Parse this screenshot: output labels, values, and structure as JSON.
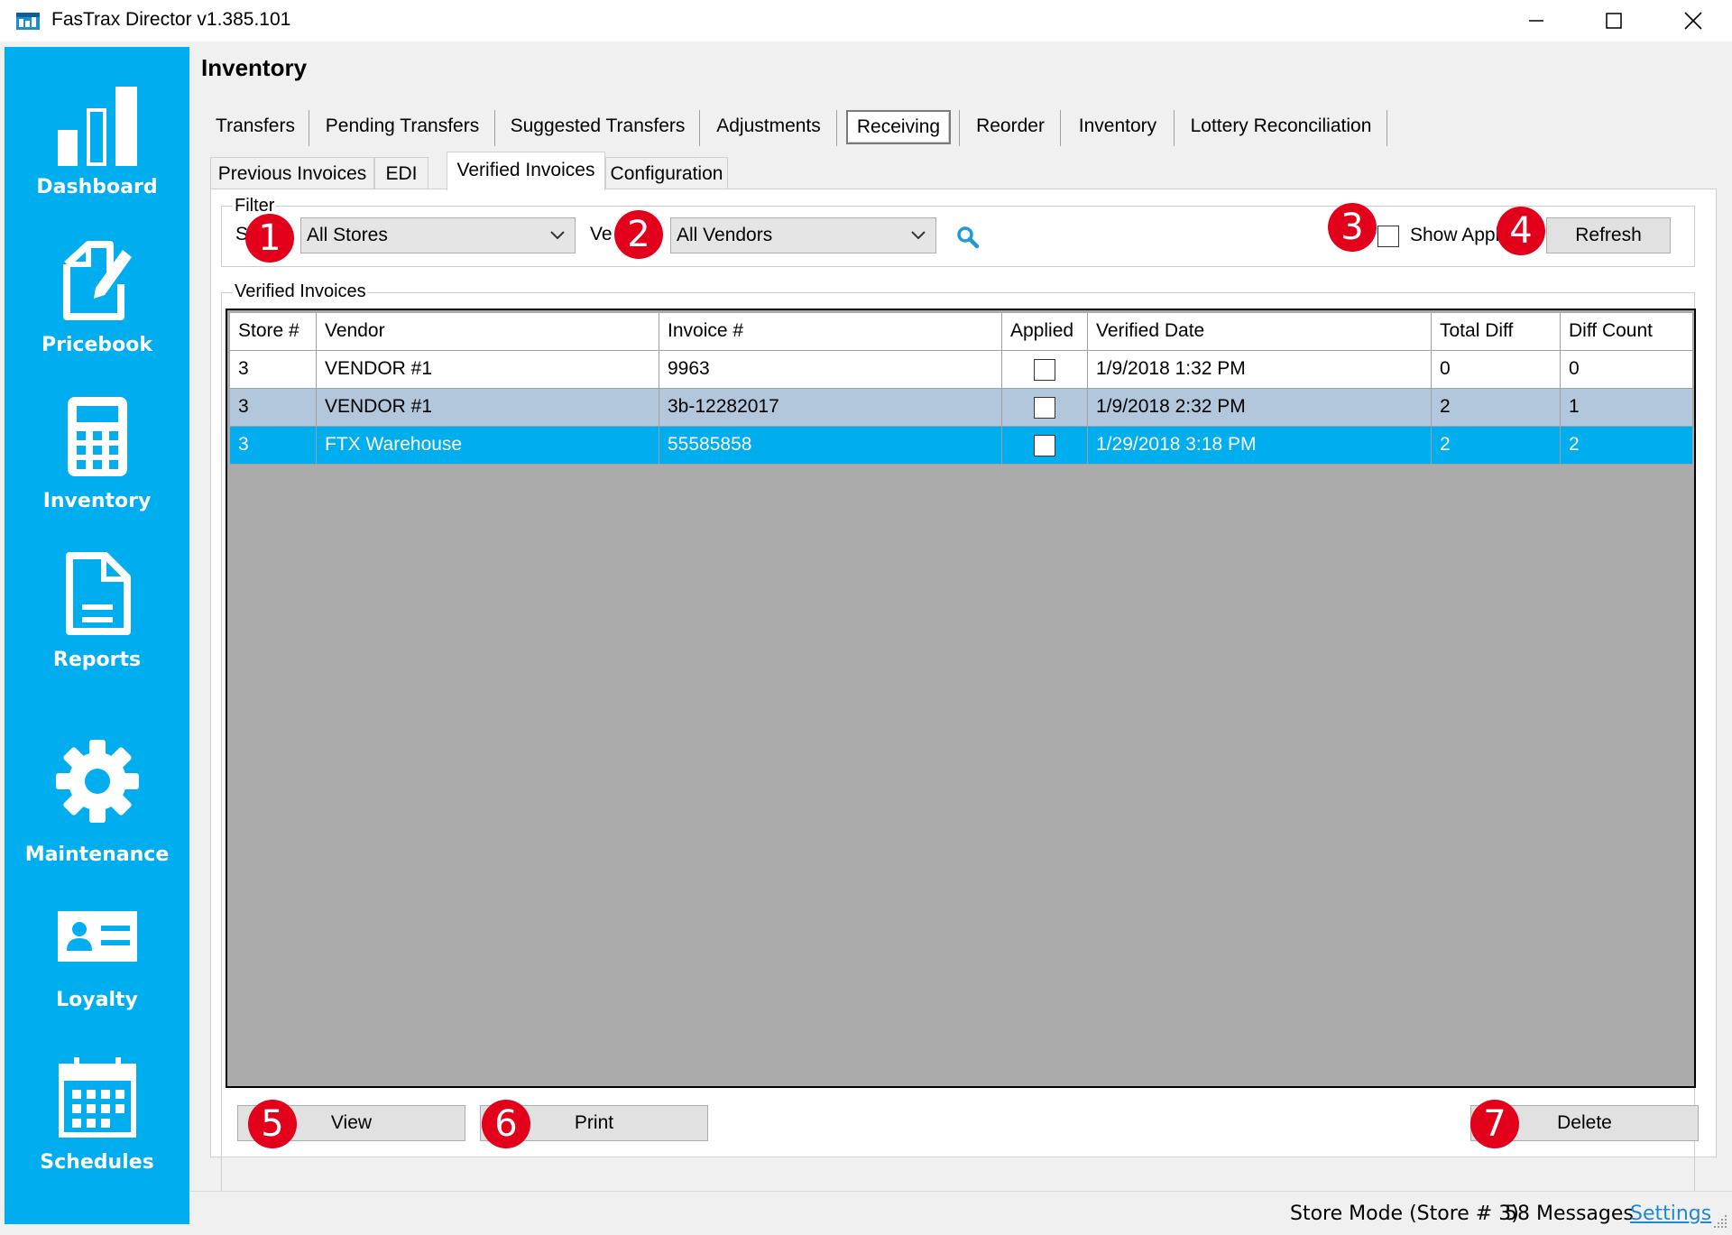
{
  "window": {
    "title": "FasTrax Director v1.385.101",
    "minimize_label": "—",
    "maximize_label": "☐",
    "close_label": "✕"
  },
  "sidebar": {
    "items": [
      {
        "label": "Dashboard",
        "icon": "bar-chart-icon"
      },
      {
        "label": "Pricebook",
        "icon": "edit-document-icon"
      },
      {
        "label": "Inventory",
        "icon": "calculator-icon"
      },
      {
        "label": "Reports",
        "icon": "document-icon"
      },
      {
        "label": "Maintenance",
        "icon": "gear-icon"
      },
      {
        "label": "Loyalty",
        "icon": "id-card-icon"
      },
      {
        "label": "Schedules",
        "icon": "calendar-icon"
      }
    ]
  },
  "page": {
    "title": "Inventory"
  },
  "main_tabs": [
    {
      "label": "Transfers"
    },
    {
      "label": "Pending Transfers"
    },
    {
      "label": "Suggested Transfers"
    },
    {
      "label": "Adjustments"
    },
    {
      "label": "Receiving",
      "active": true
    },
    {
      "label": "Reorder"
    },
    {
      "label": "Inventory"
    },
    {
      "label": "Lottery Reconciliation"
    }
  ],
  "sub_tabs": [
    {
      "label": "Previous Invoices"
    },
    {
      "label": "EDI"
    },
    {
      "label": "Verified Invoices",
      "active": true
    },
    {
      "label": "Configuration"
    }
  ],
  "filter": {
    "group_label": "Filter",
    "store_label_partial": "S",
    "store_value": "All Stores",
    "vendor_label_partial": "Ve",
    "vendor_value": "All Vendors",
    "show_applied_label": "Show Appl",
    "show_applied_checked": false,
    "refresh_label": "Refresh"
  },
  "grid": {
    "group_label": "Verified Invoices",
    "columns": [
      "Store #",
      "Vendor",
      "Invoice #",
      "Applied",
      "Verified Date",
      "Total Diff",
      "Diff Count"
    ],
    "rows": [
      {
        "store": "3",
        "vendor": "VENDOR #1",
        "invoice": "9963",
        "applied": false,
        "verified_date": "1/9/2018 1:32 PM",
        "total_diff": "0",
        "diff_count": "0",
        "state": "normal"
      },
      {
        "store": "3",
        "vendor": "VENDOR #1",
        "invoice": "3b-12282017",
        "applied": false,
        "verified_date": "1/9/2018 2:32 PM",
        "total_diff": "2",
        "diff_count": "1",
        "state": "alternate"
      },
      {
        "store": "3",
        "vendor": "FTX Warehouse",
        "invoice": "55585858",
        "applied": false,
        "verified_date": "1/29/2018 3:18 PM",
        "total_diff": "2",
        "diff_count": "2",
        "state": "selected"
      }
    ]
  },
  "actions": {
    "view_label": "View",
    "print_label": "Print",
    "delete_label": "Delete"
  },
  "callouts": [
    "1",
    "2",
    "3",
    "4",
    "5",
    "6",
    "7"
  ],
  "status": {
    "mode": "Store Mode (Store # 3)",
    "messages": "58 Messages",
    "settings_link": "Settings"
  },
  "colors": {
    "sidebar": "#00adef",
    "selected_row": "#00adef",
    "alternate_row": "#b2c6dc",
    "callout": "#e2001a",
    "search_icon": "#1e9bd7",
    "link": "#1e87d6"
  }
}
